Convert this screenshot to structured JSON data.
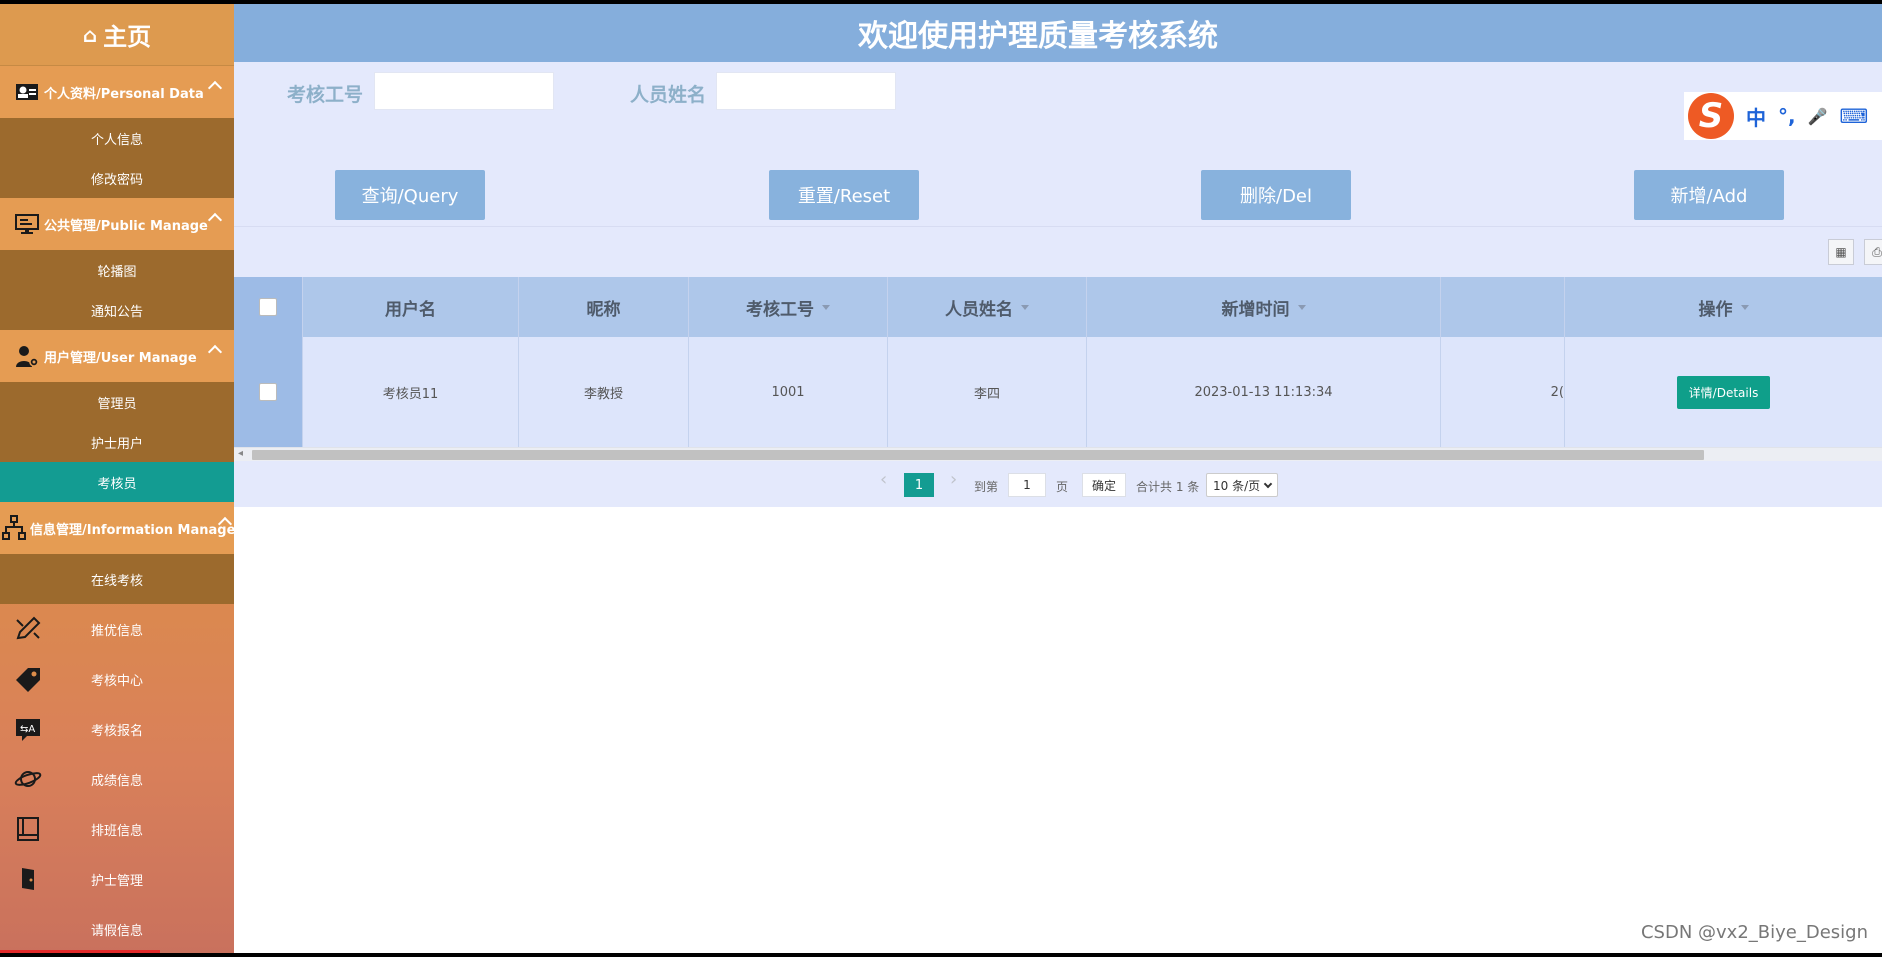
{
  "sidebar": {
    "home_label": "主页",
    "groups": [
      {
        "label": "个人资料/Personal Data",
        "items": [
          "个人信息",
          "修改密码"
        ]
      },
      {
        "label": "公共管理/Public Manage",
        "items": [
          "轮播图",
          "通知公告"
        ]
      },
      {
        "label": "用户管理/User Manage",
        "items": [
          "管理员",
          "护士用户",
          "考核员"
        ]
      },
      {
        "label": "信息管理/Information Manage",
        "items": [
          "在线考核"
        ]
      }
    ],
    "flat_items": [
      "推优信息",
      "考核中心",
      "考核报名",
      "成绩信息",
      "排班信息",
      "护士管理",
      "请假信息"
    ],
    "active_item": "考核员",
    "accent_color": "#139c92"
  },
  "header": {
    "title": "欢迎使用护理质量考核系统"
  },
  "filters": {
    "field1_label": "考核工号",
    "field1_value": "",
    "field2_label": "人员姓名",
    "field2_value": ""
  },
  "buttons": {
    "query": "查询/Query",
    "reset": "重置/Reset",
    "delete": "删除/Del",
    "add": "新增/Add"
  },
  "ime": {
    "logo": "S",
    "mode": "中",
    "punct": "°,",
    "mic": "🎤",
    "keyboard": "⌨"
  },
  "table": {
    "headers": [
      "用户名",
      "昵称",
      "考核工号",
      "人员姓名",
      "新增时间",
      "",
      "操作"
    ],
    "rows": [
      {
        "username": "考核员11",
        "nickname": "李教授",
        "id": "1001",
        "name": "李四",
        "created": "2023-01-13 11:13:34",
        "extra": "2(",
        "action": "详情/Details"
      }
    ]
  },
  "pagination": {
    "prev": "‹",
    "current": "1",
    "next": "›",
    "goto_label": "到第",
    "goto_value": "1",
    "page_unit": "页",
    "confirm": "确定",
    "total": "合计共 1 条",
    "page_size": "10 条/页"
  },
  "watermark": "CSDN @vx2_Biye_Design"
}
